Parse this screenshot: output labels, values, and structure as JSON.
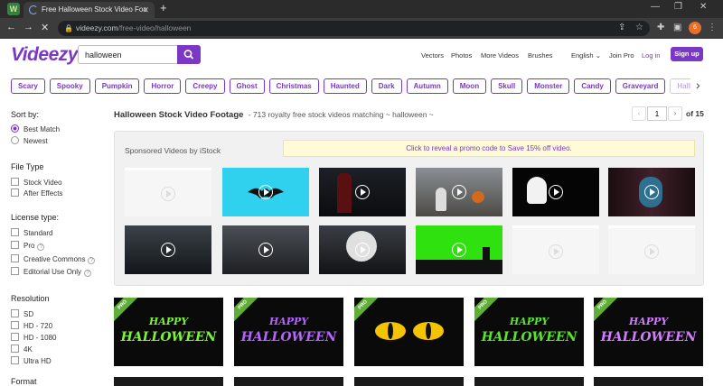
{
  "browser": {
    "tab_title": "Free Halloween Stock Video Foo",
    "url_host": "videezy.com",
    "url_path": "/free-video/halloween",
    "avatar_letter": "6"
  },
  "header": {
    "logo": "Videezy",
    "search_value": "halloween",
    "nav": [
      "Vectors",
      "Photos",
      "More Videos",
      "Brushes"
    ],
    "language": "English",
    "join_pro": "Join Pro",
    "login": "Log in",
    "signup": "Sign up"
  },
  "chips": [
    "Scary",
    "Spooky",
    "Pumpkin",
    "Horror",
    "Creepy",
    "Ghost",
    "Christmas",
    "Haunted",
    "Dark",
    "Autumn",
    "Moon",
    "Skull",
    "Monster",
    "Candy",
    "Graveyard",
    "Hallowee"
  ],
  "sidebar": {
    "sort": {
      "title": "Sort by:",
      "options": [
        "Best Match",
        "Newest"
      ],
      "selected": 0
    },
    "file_type": {
      "title": "File Type",
      "options": [
        "Stock Video",
        "After Effects"
      ]
    },
    "license": {
      "title": "License type:",
      "options": [
        "Standard",
        "Pro",
        "Creative Commons",
        "Editorial Use Only"
      ]
    },
    "resolution": {
      "title": "Resolution",
      "options": [
        "SD",
        "HD - 720",
        "HD - 1080",
        "4K",
        "Ultra HD"
      ]
    },
    "format": {
      "title": "Format"
    }
  },
  "results": {
    "title": "Halloween Stock Video Footage",
    "subtitle": "- 713 royalty free stock videos matching ~ halloween ~",
    "page": "1",
    "total": "of 15"
  },
  "sponsored": {
    "label": "Sponsored Videos by iStock",
    "promo": "Click to reveal a promo code to Save 15% off video."
  },
  "pro_badge": "PRO",
  "tiles": [
    {
      "l1": "HAPPY",
      "l2": "HALLOWEEN",
      "color": "#7cf23a"
    },
    {
      "l1": "HAPPY",
      "l2": "HALLOWEEN",
      "color": "#b463ff"
    },
    {
      "l1": "",
      "l2": "",
      "color": "#f5c400"
    },
    {
      "l1": "HAPPY",
      "l2": "HALLOWEEN",
      "color": "#55e62a"
    },
    {
      "l1": "HAPPY",
      "l2": "HALLOWEEN",
      "color": "#d27cff"
    }
  ],
  "colors": {
    "brand": "#7a38c5",
    "pro_badge": "#5fae36"
  }
}
